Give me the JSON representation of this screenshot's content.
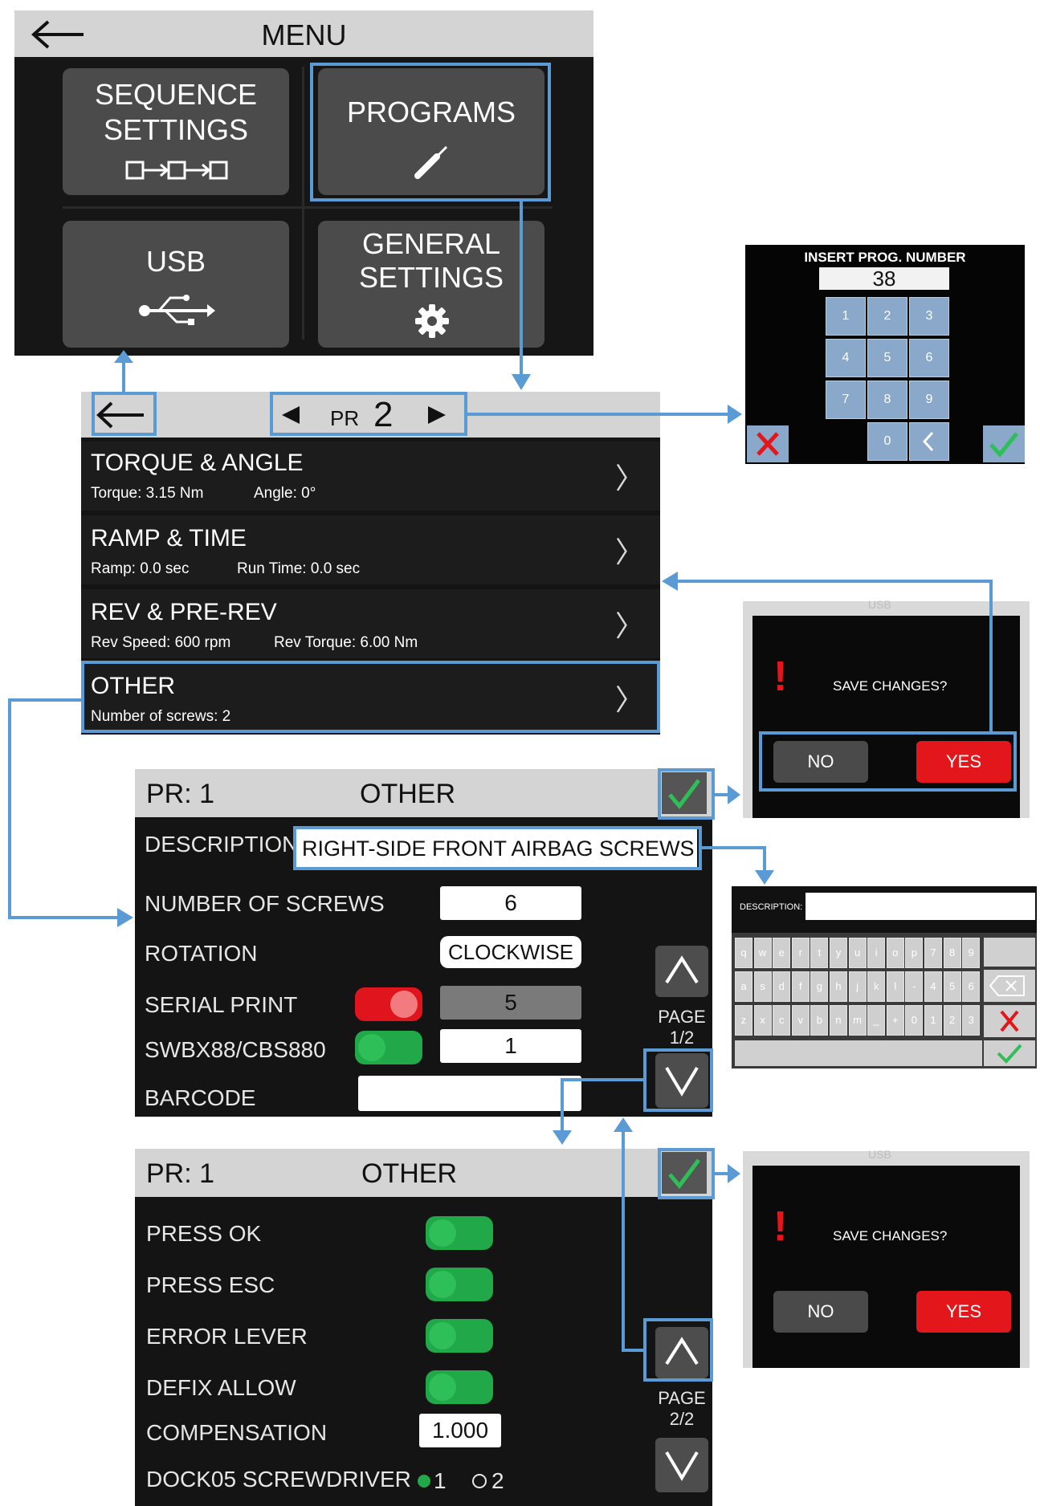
{
  "menu": {
    "title": "MENU",
    "tiles": {
      "sequence_line1": "SEQUENCE",
      "sequence_line2": "SETTINGS",
      "programs": "PROGRAMS",
      "usb": "USB",
      "general_line1": "GENERAL",
      "general_line2": "SETTINGS"
    }
  },
  "program_list": {
    "pr_prefix": "PR",
    "pr_number": "2",
    "rows": [
      {
        "title": "TORQUE & ANGLE",
        "detail1": "Torque: 3.15 Nm",
        "detail2": "Angle: 0°"
      },
      {
        "title": "RAMP & TIME",
        "detail1": "Ramp: 0.0 sec",
        "detail2": "Run Time: 0.0 sec"
      },
      {
        "title": "REV & PRE-REV",
        "detail1": "Rev Speed: 600 rpm",
        "detail2": "Rev Torque: 6.00 Nm"
      },
      {
        "title": "OTHER",
        "detail1": "Number of screws: 2",
        "detail2": ""
      }
    ]
  },
  "numpad": {
    "title": "INSERT PROG. NUMBER",
    "value": "38",
    "keys": [
      "1",
      "2",
      "3",
      "4",
      "5",
      "6",
      "7",
      "8",
      "9",
      "0"
    ]
  },
  "save_dialog": {
    "question": "SAVE CHANGES?",
    "no": "NO",
    "yes": "YES",
    "faded_header": "USB"
  },
  "other_page1": {
    "pr": "PR: 1",
    "title": "OTHER",
    "description_label": "DESCRIPTION",
    "description_value": "RIGHT-SIDE FRONT AIRBAG  SCREWS",
    "number_of_screws_label": "NUMBER OF SCREWS",
    "number_of_screws_value": "6",
    "rotation_label": "ROTATION",
    "rotation_value": "CLOCKWISE",
    "serial_print_label": "SERIAL PRINT",
    "serial_print_value": "5",
    "swbx_label": "SWBX88/CBS880",
    "swbx_value": "1",
    "barcode_label": "BARCODE",
    "page_label": "PAGE",
    "page_value": "1/2"
  },
  "other_page2": {
    "pr": "PR: 1",
    "title": "OTHER",
    "press_ok_label": "PRESS OK",
    "press_esc_label": "PRESS ESC",
    "error_lever_label": "ERROR LEVER",
    "defix_allow_label": "DEFIX ALLOW",
    "compensation_label": "COMPENSATION",
    "compensation_value": "1.000",
    "dock_label": "DOCK05 SCREWDRIVER",
    "dock_option1": "1",
    "dock_option2": "2",
    "page_label": "PAGE",
    "page_value": "2/2"
  },
  "keyboard": {
    "description_label": "DESCRIPTION:",
    "row1": [
      "q",
      "w",
      "e",
      "r",
      "t",
      "y",
      "u",
      "i",
      "o",
      "p",
      "7",
      "8",
      "9"
    ],
    "row2": [
      "a",
      "s",
      "d",
      "f",
      "g",
      "h",
      "j",
      "k",
      "l",
      "-",
      "4",
      "5",
      "6"
    ],
    "row3": [
      "z",
      "x",
      "c",
      "v",
      "b",
      "n",
      "m",
      "_",
      "+",
      "0",
      "1",
      "2",
      "3"
    ]
  },
  "colors": {
    "accent_blue": "#5b9bd5",
    "toggle_green": "#21a849",
    "toggle_red": "#e0141c",
    "yes_red": "#e3161b",
    "check_green": "#2fbf58"
  }
}
